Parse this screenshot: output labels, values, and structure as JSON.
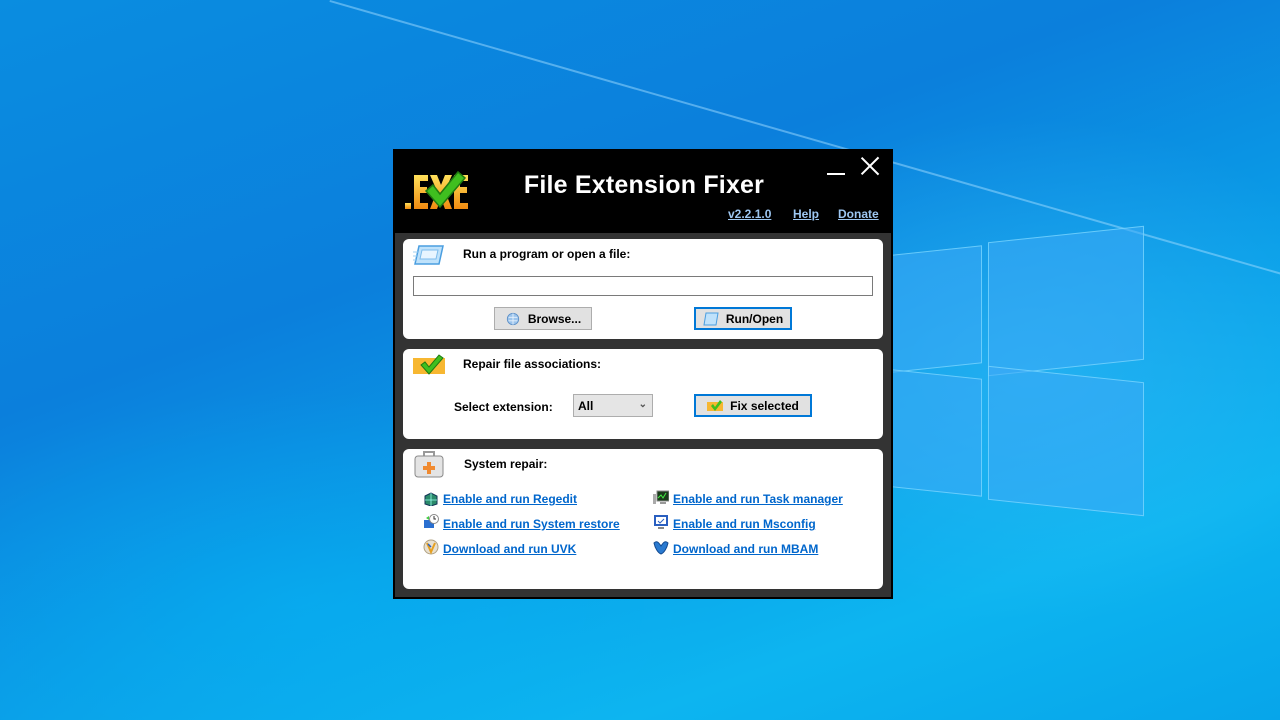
{
  "window": {
    "title": "File Extension Fixer",
    "logo_text": ".EXE",
    "controls": {
      "minimize": "minimize",
      "close": "close"
    },
    "header_links": [
      {
        "label": "v2.2.1.0"
      },
      {
        "label": "Help"
      },
      {
        "label": "Donate"
      }
    ]
  },
  "run_panel": {
    "title": "Run a program or open a file:",
    "icon": "run-window-icon",
    "path_value": "",
    "browse_label": "Browse...",
    "run_label": "Run/Open"
  },
  "repair_panel": {
    "title": "Repair file associations:",
    "icon": "exe-check-icon",
    "select_label": "Select extension:",
    "select_value": "All",
    "fix_label": "Fix selected"
  },
  "system_panel": {
    "title": "System repair:",
    "icon": "first-aid-kit-icon",
    "links_left": [
      {
        "label": "Enable and run Regedit",
        "icon": "regedit-icon"
      },
      {
        "label": "Enable and run System restore",
        "icon": "system-restore-icon"
      },
      {
        "label": "Download and run UVK",
        "icon": "uvk-icon"
      }
    ],
    "links_right": [
      {
        "label": "Enable and run Task manager",
        "icon": "task-manager-icon"
      },
      {
        "label": "Enable and run Msconfig",
        "icon": "msconfig-icon"
      },
      {
        "label": "Download and run MBAM",
        "icon": "mbam-icon"
      }
    ]
  },
  "colors": {
    "link": "#0066cc",
    "header_link": "#9dc6f0",
    "focus_border": "#0078d7",
    "panel_bg": "#ffffff",
    "frame_bg": "#333333",
    "titlebar_bg": "#000000"
  }
}
